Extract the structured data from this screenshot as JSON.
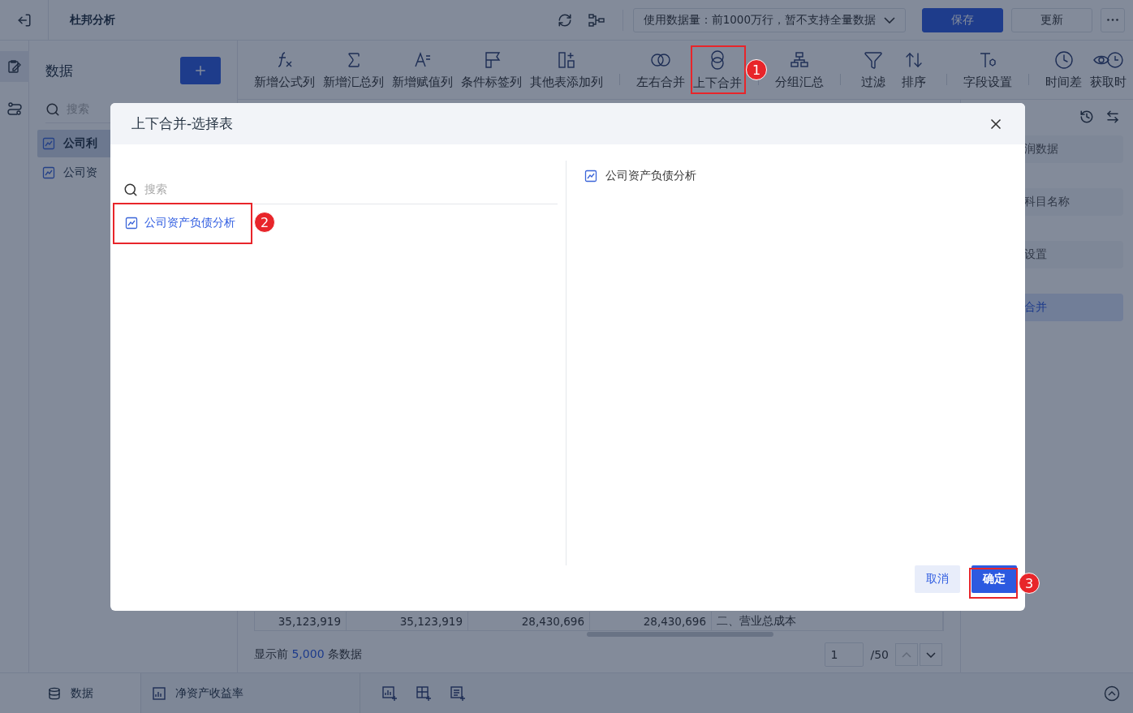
{
  "header": {
    "title": "杜邦分析",
    "data_scope": "使用数据量：前1000万行，暂不支持全量数据",
    "save": "保存",
    "update": "更新"
  },
  "sidebar": {
    "title": "数据",
    "search_placeholder": "搜索",
    "items": [
      {
        "label": "公司利",
        "selected": true
      },
      {
        "label": "公司资",
        "selected": false
      }
    ]
  },
  "toolbar": {
    "groups": [
      [
        {
          "label": "新增公式列"
        },
        {
          "label": "新增汇总列"
        },
        {
          "label": "新增赋值列"
        },
        {
          "label": "条件标签列"
        },
        {
          "label": "其他表添加列"
        }
      ],
      [
        {
          "label": "左右合并"
        },
        {
          "label": "上下合并"
        }
      ],
      [
        {
          "label": "分组汇总"
        }
      ],
      [
        {
          "label": "过滤"
        },
        {
          "label": "排序"
        }
      ],
      [
        {
          "label": "字段设置"
        }
      ],
      [
        {
          "label": "时间差"
        },
        {
          "label": "获取时"
        }
      ]
    ]
  },
  "table_row": [
    "35,123,919",
    "35,123,919",
    "28,430,696",
    "28,430,696",
    "二、营业总成本"
  ],
  "footer": {
    "prefix": "显示前",
    "count": "5,000",
    "suffix": "条数据",
    "page": "1",
    "total": "/50"
  },
  "right_panel": {
    "items": [
      {
        "label": "润数据",
        "selected": false
      },
      {
        "label": "科目名称",
        "selected": false
      },
      {
        "label": "设置",
        "selected": false
      },
      {
        "label": "合并",
        "selected": true
      }
    ]
  },
  "bottom_tabs": [
    {
      "label": "数据",
      "selected": true
    },
    {
      "label": "净资产收益率",
      "selected": false
    }
  ],
  "dialog": {
    "title": "上下合并-选择表",
    "search_placeholder": "搜索",
    "tables": [
      {
        "label": "公司资产负债分析",
        "selected": true
      }
    ],
    "selected_tables": [
      {
        "label": "公司资产负债分析"
      }
    ],
    "cancel": "取消",
    "confirm": "确定"
  },
  "annotations": [
    {
      "number": "1"
    },
    {
      "number": "2"
    },
    {
      "number": "3"
    }
  ]
}
